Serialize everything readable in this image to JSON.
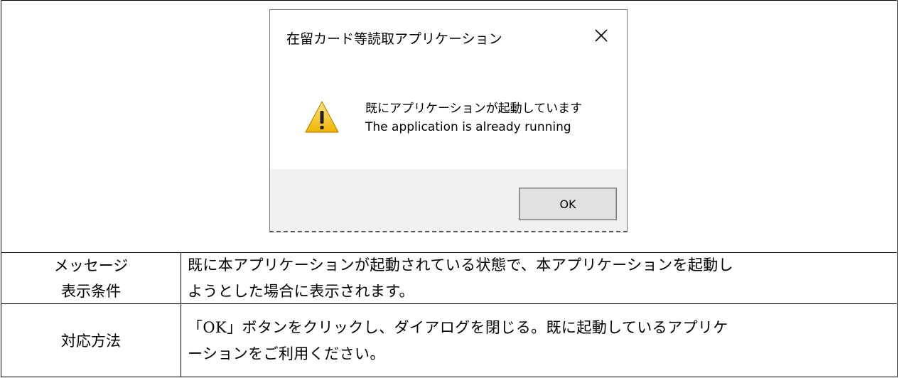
{
  "dialog": {
    "title": "在留カード等読取アプリケーション",
    "close_icon": "close-icon",
    "icon": "warning-icon",
    "message_ja": "既にアプリケーションが起動しています",
    "message_en": "The application is already running",
    "ok_label": "OK",
    "colors": {
      "footer": "#f0f0f0",
      "button": "#e1e1e1",
      "warning_fill": "#f5c518"
    }
  },
  "table": {
    "condition": {
      "label_line1": "メッセージ",
      "label_line2": "表示条件",
      "text_line1": "既に本アプリケーションが起動されている状態で、本アプリケーションを起動し",
      "text_line2": "ようとした場合に表示されます。"
    },
    "action": {
      "label": "対応方法",
      "text_line1": "「OK」ボタンをクリックし、ダイアログを閉じる。既に起動しているアプリケ",
      "text_line2": "ーションをご利用ください。"
    }
  }
}
